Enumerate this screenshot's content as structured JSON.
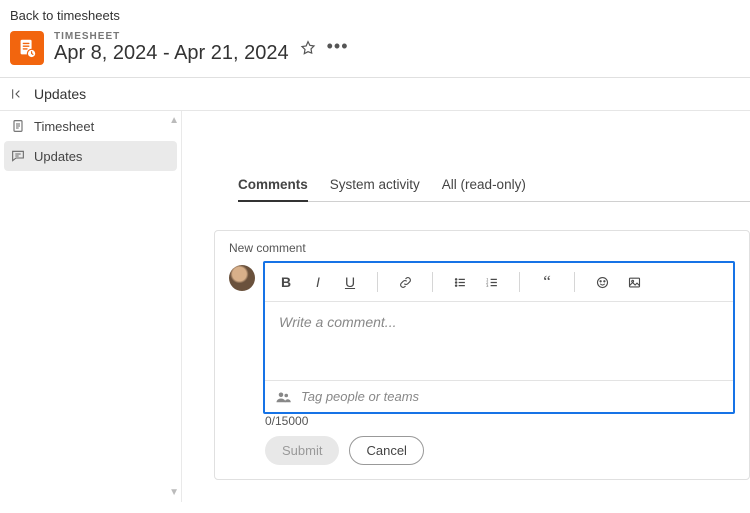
{
  "back_link": "Back to timesheets",
  "header": {
    "eyebrow": "TIMESHEET",
    "title": "Apr 8, 2024 - Apr 21, 2024"
  },
  "breadcrumb": "Updates",
  "sidebar": {
    "items": [
      {
        "label": "Timesheet"
      },
      {
        "label": "Updates"
      }
    ]
  },
  "tabs": [
    {
      "label": "Comments",
      "active": true
    },
    {
      "label": "System activity",
      "active": false
    },
    {
      "label": "All (read-only)",
      "active": false
    }
  ],
  "editor": {
    "section_label": "New comment",
    "placeholder": "Write a comment...",
    "tag_placeholder": "Tag people or teams",
    "counter": "0/15000",
    "submit": "Submit",
    "cancel": "Cancel"
  }
}
